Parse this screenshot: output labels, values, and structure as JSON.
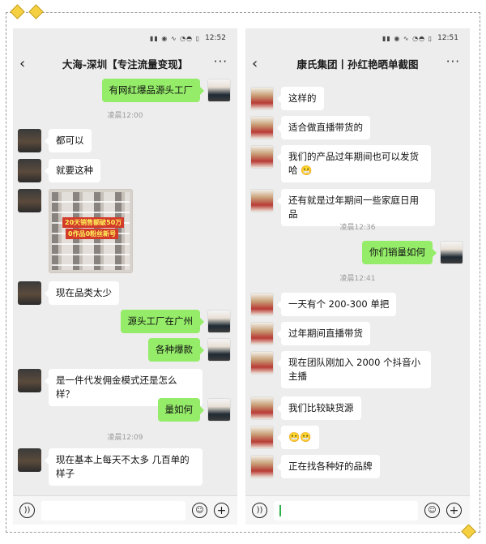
{
  "left": {
    "status_time": "12:52",
    "status_icons": "▮▮ ◉ ∿ ◔◓ ▯",
    "title": "大海-深圳【专注流量变现】",
    "back_icon": "chevron-left-icon",
    "more_icon": "more-icon",
    "messages": [
      {
        "side": "out",
        "avatar": "man2",
        "text": "有网红爆品源头工厂"
      },
      {
        "time": "凌晨12:00"
      },
      {
        "side": "in",
        "avatar": "man1",
        "text": "都可以"
      },
      {
        "side": "in",
        "avatar": "man1",
        "text": "就要这种"
      },
      {
        "side": "in",
        "avatar": "man1",
        "image": true,
        "image_text_1": "20天销售额破50万",
        "image_text_2": "0作品0粉丝新号"
      },
      {
        "side": "in",
        "avatar": "man1",
        "text": "现在品类太少"
      },
      {
        "side": "out",
        "avatar": "man2",
        "text": "源头工厂在广州"
      },
      {
        "side": "out",
        "avatar": "man2",
        "text": "各种爆款"
      },
      {
        "side": "in",
        "avatar": "man1",
        "text": "是一件代发佣金模式还是怎么样？"
      },
      {
        "side": "out",
        "avatar": "man2",
        "text": "量如何"
      },
      {
        "time": "凌晨12:09"
      },
      {
        "side": "in",
        "avatar": "man1",
        "text": "现在基本上每天不太多 几百单的样子"
      }
    ]
  },
  "right": {
    "status_time": "12:51",
    "status_icons": "▮▮ ◉ ∿ ◔◓ ▯",
    "title": "康氏集团丨孙红艳晒单截图",
    "back_icon": "chevron-left-icon",
    "more_icon": "more-icon",
    "messages": [
      {
        "side": "in",
        "avatar": "woman",
        "text": "这样的"
      },
      {
        "side": "in",
        "avatar": "woman",
        "text": "适合做直播带货的"
      },
      {
        "side": "in",
        "avatar": "woman",
        "text": "我们的产品过年期间也可以发货哈 😬"
      },
      {
        "side": "in",
        "avatar": "woman",
        "text": "还有就是过年期间一些家庭日用品"
      },
      {
        "time": "凌晨12:36"
      },
      {
        "side": "out",
        "avatar": "man2",
        "text": "你们销量如何"
      },
      {
        "time": "凌晨12:41"
      },
      {
        "side": "in",
        "avatar": "woman",
        "text": "一天有个 200-300 单把"
      },
      {
        "side": "in",
        "avatar": "woman",
        "text": "过年期间直播带货"
      },
      {
        "side": "in",
        "avatar": "woman",
        "text": "现在团队刚加入 2000 个抖音小主播"
      },
      {
        "side": "in",
        "avatar": "woman",
        "text": "我们比较缺货源"
      },
      {
        "side": "in",
        "avatar": "woman",
        "text": "😬😬"
      },
      {
        "side": "in",
        "avatar": "woman",
        "text": "正在找各种好的品牌"
      }
    ]
  },
  "inputbar": {
    "voice_icon": "voice-icon",
    "emoji_icon": "emoji-icon",
    "plus_icon": "plus-icon"
  },
  "colors": {
    "outgoing_bubble": "#95ec69",
    "incoming_bubble": "#ffffff",
    "chat_background": "#ededed",
    "accent_diamond": "#f5d142"
  }
}
